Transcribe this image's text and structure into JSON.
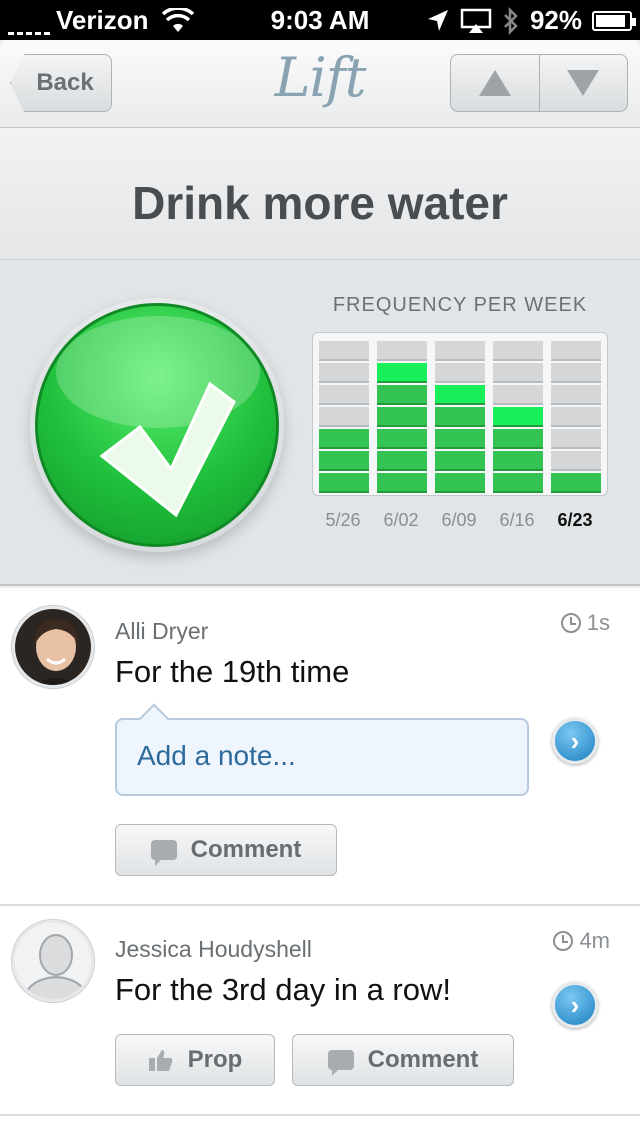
{
  "status_bar": {
    "carrier": "Verizon",
    "time": "9:03 AM",
    "battery": "92%"
  },
  "nav": {
    "back_label": "Back",
    "logo": "Lift"
  },
  "habit": {
    "title": "Drink more water",
    "frequency_label": "FREQUENCY PER WEEK",
    "checked": true
  },
  "chart_data": {
    "type": "bar",
    "title": "FREQUENCY PER WEEK",
    "categories": [
      "5/26",
      "6/02",
      "6/09",
      "6/16",
      "6/23"
    ],
    "values": [
      3,
      6,
      5,
      4,
      1
    ],
    "ylim": [
      0,
      7
    ],
    "current_week": "6/23",
    "colors": {
      "filled": "#34c453",
      "latest": "#18ef5a",
      "empty": "#d4d6d8"
    }
  },
  "feed": [
    {
      "user": "Alli Dryer",
      "activity": "For the 19th time",
      "time": "1s",
      "note_placeholder": "Add a note...",
      "comment_label": "Comment"
    },
    {
      "user": "Jessica Houdyshell",
      "activity": "For the 3rd day in a row!",
      "time": "4m",
      "prop_label": "Prop",
      "comment_label": "Comment"
    }
  ]
}
